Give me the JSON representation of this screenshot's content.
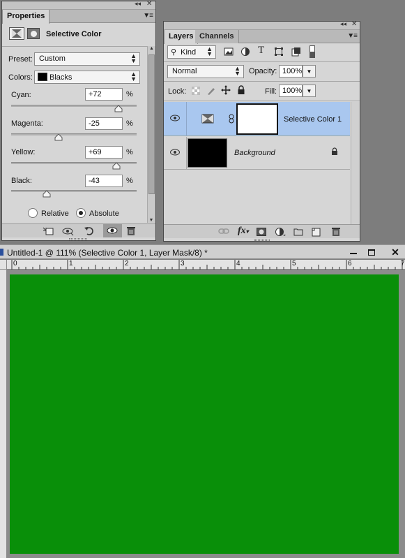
{
  "properties_panel": {
    "tab_label": "Properties",
    "title": "Selective Color",
    "preset_label": "Preset:",
    "preset_value": "Custom",
    "colors_label": "Colors:",
    "colors_value": "Blacks",
    "colors_swatch": "#000000",
    "sliders": [
      {
        "label": "Cyan:",
        "value": "+72",
        "unit": "%",
        "percent": 72
      },
      {
        "label": "Magenta:",
        "value": "-25",
        "unit": "%",
        "percent": -25
      },
      {
        "label": "Yellow:",
        "value": "+69",
        "unit": "%",
        "percent": 69
      },
      {
        "label": "Black:",
        "value": "-43",
        "unit": "%",
        "percent": -43
      }
    ],
    "method_options": [
      {
        "label": "Relative",
        "selected": false
      },
      {
        "label": "Absolute",
        "selected": true
      }
    ],
    "footer_icons": [
      "clip-to-layer-icon",
      "view-previous-icon",
      "reset-icon",
      "visibility-icon",
      "delete-icon"
    ]
  },
  "layers_panel": {
    "tabs": [
      {
        "label": "Layers",
        "active": true
      },
      {
        "label": "Channels",
        "active": false
      }
    ],
    "filter_kind": "Kind",
    "filter_icons": [
      "pixel-filter-icon",
      "adjustment-filter-icon",
      "type-filter-icon",
      "shape-filter-icon",
      "smart-object-filter-icon"
    ],
    "blend_mode": "Normal",
    "opacity_label": "Opacity:",
    "opacity_value": "100%",
    "lock_label": "Lock:",
    "fill_label": "Fill:",
    "fill_value": "100%",
    "layers": [
      {
        "name": "Selective Color 1",
        "selected": true,
        "visible": true,
        "mask_color": "#ffffff"
      },
      {
        "name": "Background",
        "selected": false,
        "visible": true,
        "thumb_color": "#000000",
        "locked": true
      }
    ],
    "footer_icons": [
      "link-layers-icon",
      "fx-icon",
      "add-mask-icon",
      "new-adjustment-icon",
      "new-group-icon",
      "new-layer-icon",
      "delete-layer-icon"
    ]
  },
  "document": {
    "title": "Untitled-1 @ 111% (Selective Color 1, Layer Mask/8) *",
    "ruler_labels": [
      "0",
      "1",
      "2",
      "3",
      "4",
      "5",
      "6",
      "7"
    ],
    "canvas_color": "#098f09",
    "window_buttons": [
      "minimize",
      "maximize",
      "close"
    ]
  },
  "colors": {
    "selected_layer_bg": "#a9c7ef",
    "panel_bg": "#d6d6d6"
  }
}
